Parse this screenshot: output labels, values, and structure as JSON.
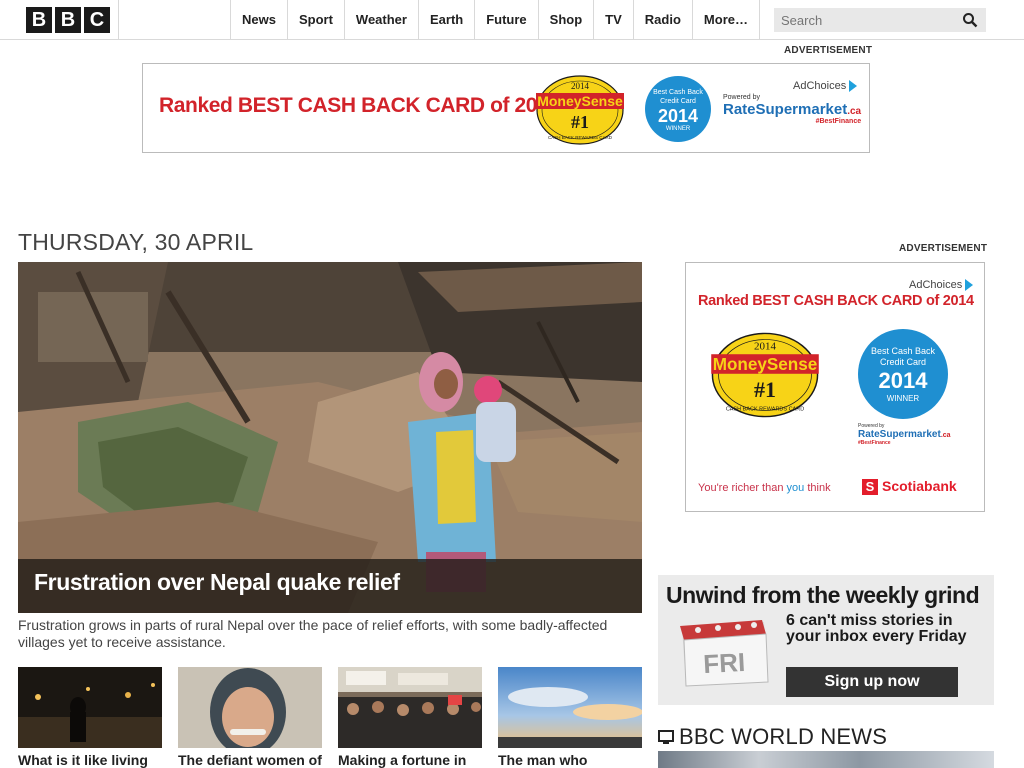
{
  "header": {
    "logo_letters": [
      "B",
      "B",
      "C"
    ],
    "nav_items": [
      "News",
      "Sport",
      "Weather",
      "Earth",
      "Future",
      "Shop",
      "TV",
      "Radio",
      "More…"
    ],
    "search_placeholder": "Search"
  },
  "top_ad": {
    "label": "ADVERTISEMENT",
    "headline": "Ranked BEST CASH BACK CARD of 2014",
    "moneysense": {
      "year": "2014",
      "brand": "MoneySense",
      "rank": "#1",
      "tag": "CASH BACK REWARDS CARD"
    },
    "badge": {
      "line1": "Best Cash Back",
      "line2": "Credit Card",
      "year": "2014",
      "tag": "WINNER"
    },
    "adchoices": "AdChoices",
    "powered_by": "Powered by",
    "rsm_brand": "RateSupermarket",
    "rsm_tld": ".ca",
    "rsm_hashtag": "#BestFinance"
  },
  "date": "THURSDAY, 30 APRIL",
  "hero": {
    "headline": "Frustration over Nepal quake relief",
    "summary": "Frustration grows in parts of rural Nepal over the pace of relief efforts, with some badly-affected villages yet to receive assistance."
  },
  "thumbs": [
    {
      "title": "What is it like living"
    },
    {
      "title": "The defiant women of"
    },
    {
      "title": "Making a fortune in"
    },
    {
      "title": "The man who"
    }
  ],
  "side_ad": {
    "label": "ADVERTISEMENT",
    "adchoices": "AdChoices",
    "headline": "Ranked BEST CASH BACK CARD of 2014",
    "moneysense": {
      "year": "2014",
      "brand": "MoneySense",
      "rank": "#1",
      "tag": "CASH BACK REWARDS CARD"
    },
    "badge": {
      "line1": "Best Cash Back",
      "line2": "Credit Card",
      "year": "2014",
      "tag": "WINNER"
    },
    "powered_by": "Powered by",
    "rsm_brand": "RateSupermarket",
    "rsm_tld": ".ca",
    "rsm_hashtag": "#BestFinance",
    "tagline_a": "You're richer than ",
    "tagline_b": "you",
    "tagline_c": " think",
    "scotia_brand": "Scotiabank"
  },
  "promo": {
    "title": "Unwind from the weekly grind",
    "subtitle": "6 can't miss stories in your inbox every Friday",
    "button": "Sign up now",
    "calendar_text": "FRI"
  },
  "world_news": {
    "title": "BBC WORLD NEWS"
  },
  "colors": {
    "brand_red": "#d2232a",
    "badge_blue": "#1f8fd1",
    "scotia_red": "#e31d2b"
  }
}
